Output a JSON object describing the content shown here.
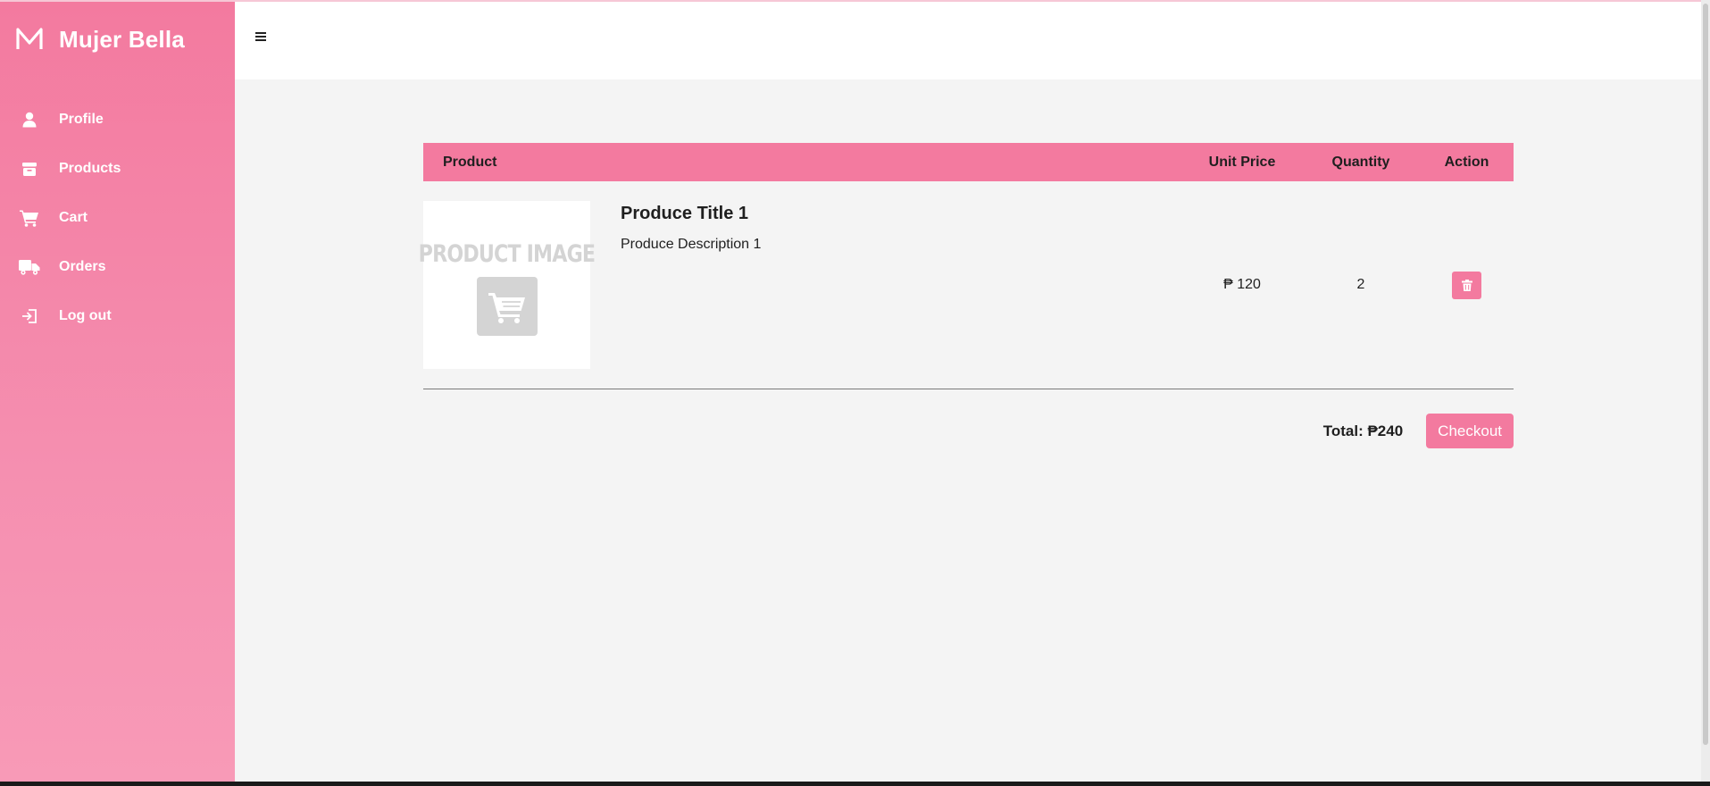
{
  "brand": {
    "logo_letter": "M",
    "name": "Mujer Bella"
  },
  "sidebar": {
    "items": [
      {
        "label": "Profile",
        "icon": "user-icon"
      },
      {
        "label": "Products",
        "icon": "box-icon"
      },
      {
        "label": "Cart",
        "icon": "cart-icon"
      },
      {
        "label": "Orders",
        "icon": "truck-icon"
      },
      {
        "label": "Log out",
        "icon": "logout-icon"
      }
    ]
  },
  "topbar": {
    "menu_icon": "hamburger-icon"
  },
  "cart": {
    "headers": {
      "product": "Product",
      "unit_price": "Unit Price",
      "quantity": "Quantity",
      "action": "Action"
    },
    "items": [
      {
        "image_text": "PRODUCT IMAGE",
        "title": "Produce Title 1",
        "description": "Produce Description 1",
        "unit_price": "₱ 120",
        "quantity": "2",
        "delete_icon": "trash-icon"
      }
    ],
    "total": "Total: ₱240",
    "checkout_label": "Checkout"
  },
  "colors": {
    "accent": "#f37a9f",
    "sidebar_bottom": "#f89ab7",
    "background": "#f4f4f4"
  }
}
